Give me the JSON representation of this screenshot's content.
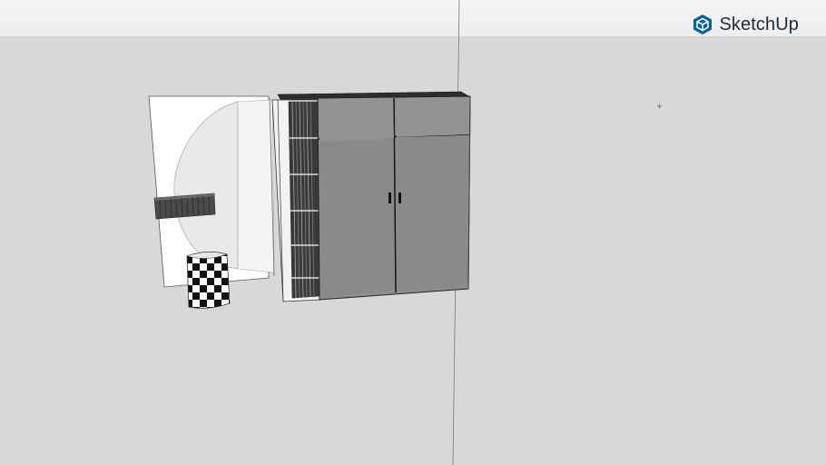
{
  "app": {
    "brand_name": "SketchUp",
    "logo_icon": "sketchup-logo-icon"
  },
  "scene": {
    "model": "cabinet-model",
    "colors": {
      "ground": "#d8d8d8",
      "sky": "#eef0f1",
      "cabinet_face": "#8d8d8d",
      "wall_panel": "#ffffff",
      "brand_blue": "#005f9e"
    }
  }
}
